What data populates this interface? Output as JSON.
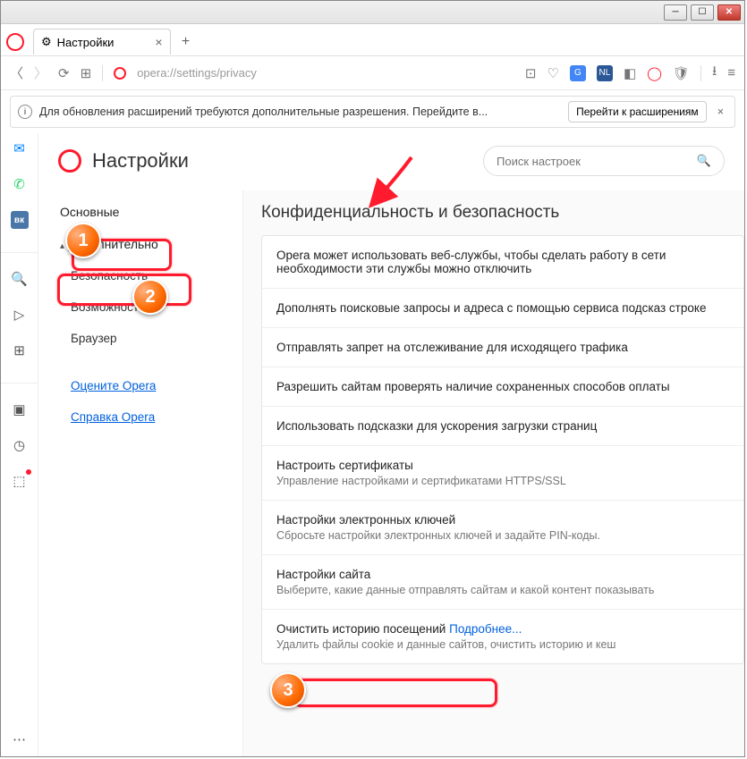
{
  "tab": {
    "title": "Настройки"
  },
  "url": "opera://settings/privacy",
  "infobar": {
    "message": "Для обновления расширений требуются дополнительные разрешения. Перейдите в...",
    "button": "Перейти к расширениям"
  },
  "header": {
    "title": "Настройки"
  },
  "search": {
    "placeholder": "Поиск настроек"
  },
  "sidebar": {
    "items": [
      {
        "label": "Основные"
      },
      {
        "label": "Дополнительно"
      },
      {
        "label": "Безопасность"
      },
      {
        "label": "Возможности"
      },
      {
        "label": "Браузер"
      }
    ],
    "links": [
      {
        "label": "Оцените Opera"
      },
      {
        "label": "Справка Opera"
      }
    ]
  },
  "main": {
    "section_title": "Конфиденциальность и безопасность",
    "rows": [
      {
        "title": "Opera может использовать веб-службы, чтобы сделать работу в сети необходимости эти службы можно отключить"
      },
      {
        "title": "Дополнять поисковые запросы и адреса с помощью сервиса подсказ строке"
      },
      {
        "title": "Отправлять запрет на отслеживание для исходящего трафика"
      },
      {
        "title": "Разрешить сайтам проверять наличие сохраненных способов оплаты"
      },
      {
        "title": "Использовать подсказки для ускорения загрузки страниц"
      },
      {
        "title": "Настроить сертификаты",
        "sub": "Управление настройками и сертификатами HTTPS/SSL"
      },
      {
        "title": "Настройки электронных ключей",
        "sub": "Сбросьте настройки электронных ключей и задайте PIN-коды."
      },
      {
        "title": "Настройки сайта",
        "sub": "Выберите, какие данные отправлять сайтам и какой контент показывать"
      },
      {
        "title": "Очистить историю посещений",
        "sub": "Удалить файлы cookie и данные сайтов, очистить историю и кеш",
        "learn": "Подробнее..."
      }
    ]
  },
  "callouts": {
    "a": "1",
    "b": "2",
    "c": "3"
  }
}
